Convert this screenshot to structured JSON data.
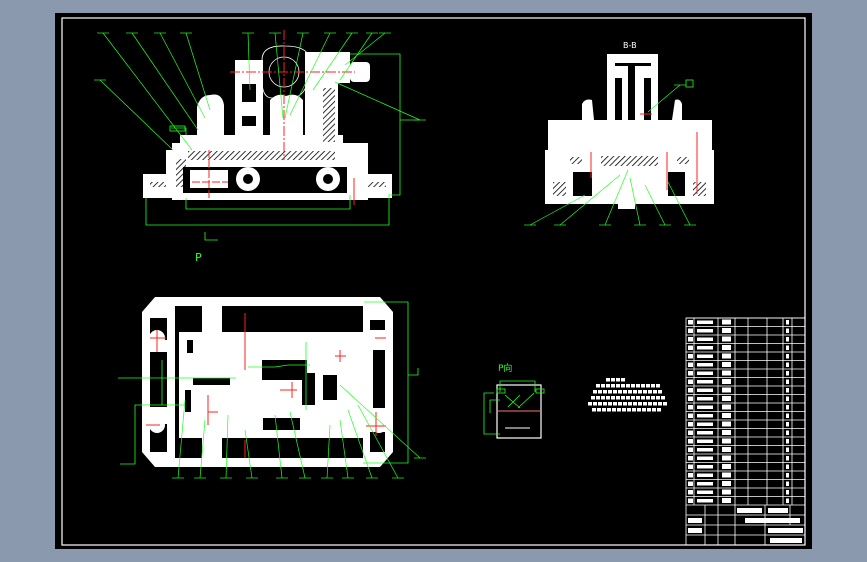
{
  "app": {
    "background_color": "#8a99ad",
    "canvas_color": "#000000"
  },
  "drawing": {
    "colors": {
      "geometry": "#ffffff",
      "leader_lines": "#22ff22",
      "center_lines": "#ff2020"
    },
    "views": {
      "section_view_label": "B-B",
      "direction_arrow_label": "P",
      "direction_view_label": "P向"
    }
  }
}
